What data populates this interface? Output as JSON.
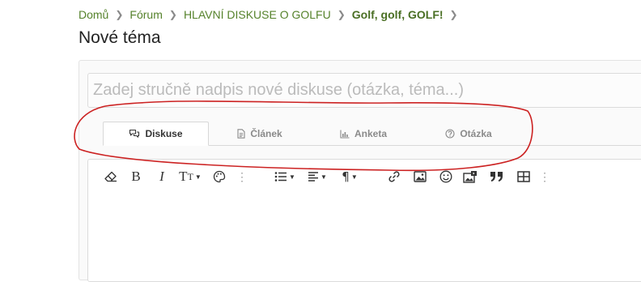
{
  "breadcrumb": {
    "items": [
      "Domů",
      "Fórum",
      "HLAVNÍ DISKUSE O GOLFU",
      "Golf, golf, GOLF!"
    ],
    "separator": ">"
  },
  "page": {
    "title": "Nové téma"
  },
  "title_input": {
    "placeholder": "Zadej stručně nadpis nové diskuse (otázka, téma...)",
    "value": ""
  },
  "tabs": [
    {
      "label": "Diskuse",
      "icon": "chat-bubbles-icon",
      "active": true
    },
    {
      "label": "Článek",
      "icon": "document-icon",
      "active": false
    },
    {
      "label": "Anketa",
      "icon": "bar-chart-icon",
      "active": false
    },
    {
      "label": "Otázka",
      "icon": "question-circle-icon",
      "active": false
    }
  ],
  "toolbar": {
    "buttons": [
      "eraser-icon",
      "bold-icon",
      "italic-icon",
      "text-size-icon",
      "palette-icon",
      "more-icon",
      "list-icon",
      "align-icon",
      "paragraph-icon",
      "more-icon",
      "link-icon",
      "image-icon",
      "emoji-icon",
      "media-icon",
      "quote-icon",
      "table-icon",
      "more-icon"
    ],
    "bold_label": "B",
    "italic_label": "I",
    "text_size_label": "T",
    "paragraph_label": "¶"
  },
  "colors": {
    "breadcrumb_link": "#55822b",
    "annotation_stroke": "#cc2222",
    "text_dark": "#222222",
    "tab_inactive": "#8a8a8a"
  }
}
